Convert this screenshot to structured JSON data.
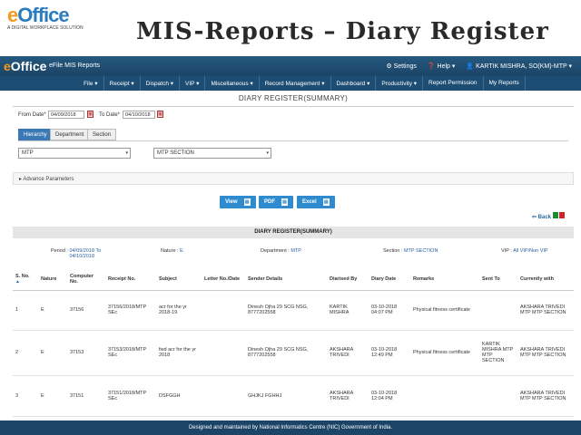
{
  "slide": {
    "logo_e": "e",
    "logo_rest": "Office",
    "logo_sub": "A DIGITAL WORKPLACE SOLUTION",
    "title": "MIS-Reports – Diary Register"
  },
  "topbar": {
    "brand_e": "e",
    "brand_rest": "Office",
    "app_name": "eFile MIS Reports",
    "settings": "⚙ Settings",
    "help": "❓ Help ▾",
    "user": "👤 KARTIK MISHRA, SO(KM)-MTP ▾"
  },
  "menu": [
    "File ▾",
    "Receipt ▾",
    "Dispatch ▾",
    "VIP ▾",
    "Miscellaneous ▾",
    "Record Management ▾",
    "Dashboard ▾",
    "Productivity ▾",
    "Report Permission",
    "My Reports"
  ],
  "report": {
    "title": "DIARY REGISTER(SUMMARY)",
    "from_label": "From Date*",
    "from_value": "04/09/2018",
    "to_label": "To Date*",
    "to_value": "04/10/2018",
    "tabs": [
      "Hierarchy",
      "Department",
      "Section"
    ],
    "select1": "MTP",
    "select2": "MTP SECTION",
    "advance": "▸ Advance Parameters",
    "buttons": {
      "view": "View",
      "pdf": "PDF",
      "excel": "Excel"
    },
    "back": "⇦ Back",
    "summary_title": "DIARY REGISTER(SUMMARY)"
  },
  "meta": {
    "period_label": "Period :",
    "period_value": "04/09/2018 To 04/10/2018",
    "nature_label": "Nature :",
    "nature_value": "E",
    "department_label": "Department :",
    "department_value": "MTP",
    "section_label": "Section :",
    "section_value": "MTP SECTION",
    "vip_label": "VIP :",
    "vip_value": "All VIP/Non VIP"
  },
  "table": {
    "headers": [
      "S. No.",
      "Nature",
      "Computer No.",
      "Receipt No.",
      "Subject",
      "Letter No./Date",
      "Sender Details",
      "Diarised By",
      "Diary Date",
      "Remarks",
      "Sent To",
      "Currently with"
    ],
    "rows": [
      [
        "1",
        "E",
        "37156",
        "37156/2018/MTP SEc",
        "acr for the yr 2018-19",
        "",
        "Dinesh Ojha 29 SCG NSG, 8777202558",
        "KARTIK MISHRA",
        "03-10-2018 04:07 PM",
        "Physical fitness certificate",
        "",
        "AKSHARA TRIVEDI MTP MTP SECTION"
      ],
      [
        "2",
        "E",
        "37153",
        "37153/2018/MTP SEc",
        "fwd acr for the yr 2018",
        "",
        "Dinesh Ojha 29 SCG NSG, 8777202558",
        "AKSHARA TRIVEDI",
        "03-10-2018 12:49 PM",
        "Physical fitness certificate",
        "KARTIK MISHRA MTP MTP SECTION",
        "AKSHARA TRIVEDI MTP MTP SECTION"
      ],
      [
        "3",
        "E",
        "37151",
        "37151/2018/MTP SEc",
        "DSFGGH",
        "",
        "GHJKJ FGHHJ",
        "AKSHARA TRIVEDI",
        "03-10-2018 12:04 PM",
        "",
        "",
        "AKSHARA TRIVEDI MTP MTP SECTION"
      ],
      [
        "",
        "",
        "",
        "",
        "",
        "",
        "",
        "",
        "",
        "",
        "",
        "AKSHARA"
      ]
    ]
  },
  "footer": "Designed and maintained by National Informatics Centre (NIC) Government of India."
}
